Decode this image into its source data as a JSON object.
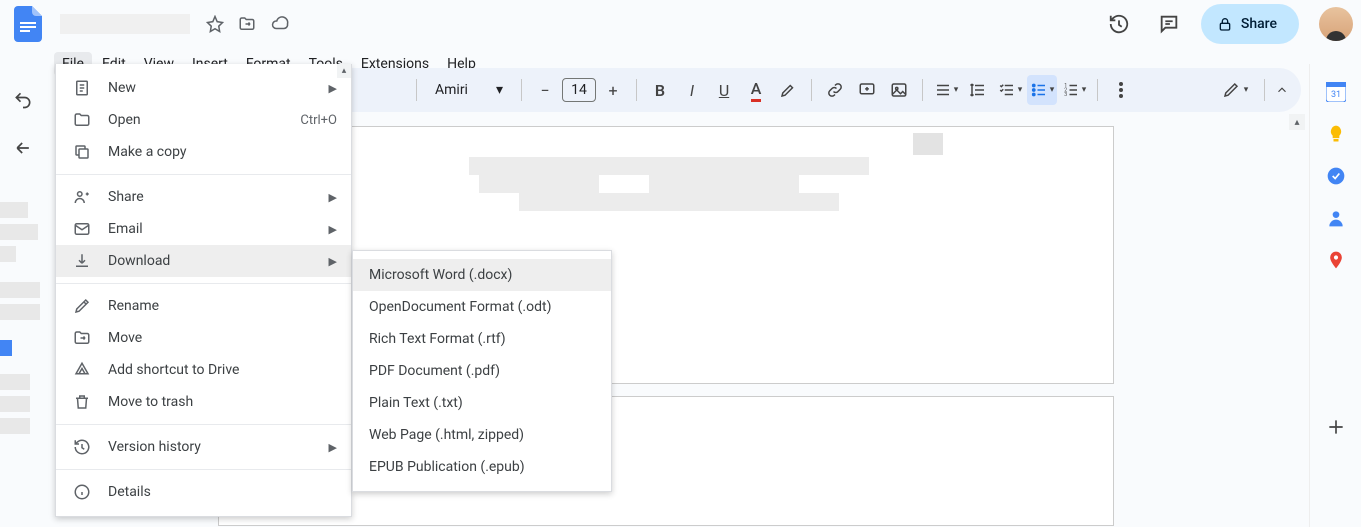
{
  "header": {
    "share_label": "Share"
  },
  "menubar": {
    "file": "File",
    "edit": "Edit",
    "view": "View",
    "insert": "Insert",
    "format": "Format",
    "tools": "Tools",
    "extensions": "Extensions",
    "help": "Help"
  },
  "toolbar": {
    "font": "Amiri",
    "size": "14"
  },
  "file_menu": {
    "new": "New",
    "open": "Open",
    "open_shortcut": "Ctrl+O",
    "make_copy": "Make a copy",
    "share": "Share",
    "email": "Email",
    "download": "Download",
    "rename": "Rename",
    "move": "Move",
    "add_shortcut": "Add shortcut to Drive",
    "move_trash": "Move to trash",
    "version_history": "Version history",
    "details": "Details"
  },
  "download_submenu": {
    "docx": "Microsoft Word (.docx)",
    "odt": "OpenDocument Format (.odt)",
    "rtf": "Rich Text Format (.rtf)",
    "pdf": "PDF Document (.pdf)",
    "txt": "Plain Text (.txt)",
    "html": "Web Page (.html, zipped)",
    "epub": "EPUB Publication (.epub)"
  }
}
